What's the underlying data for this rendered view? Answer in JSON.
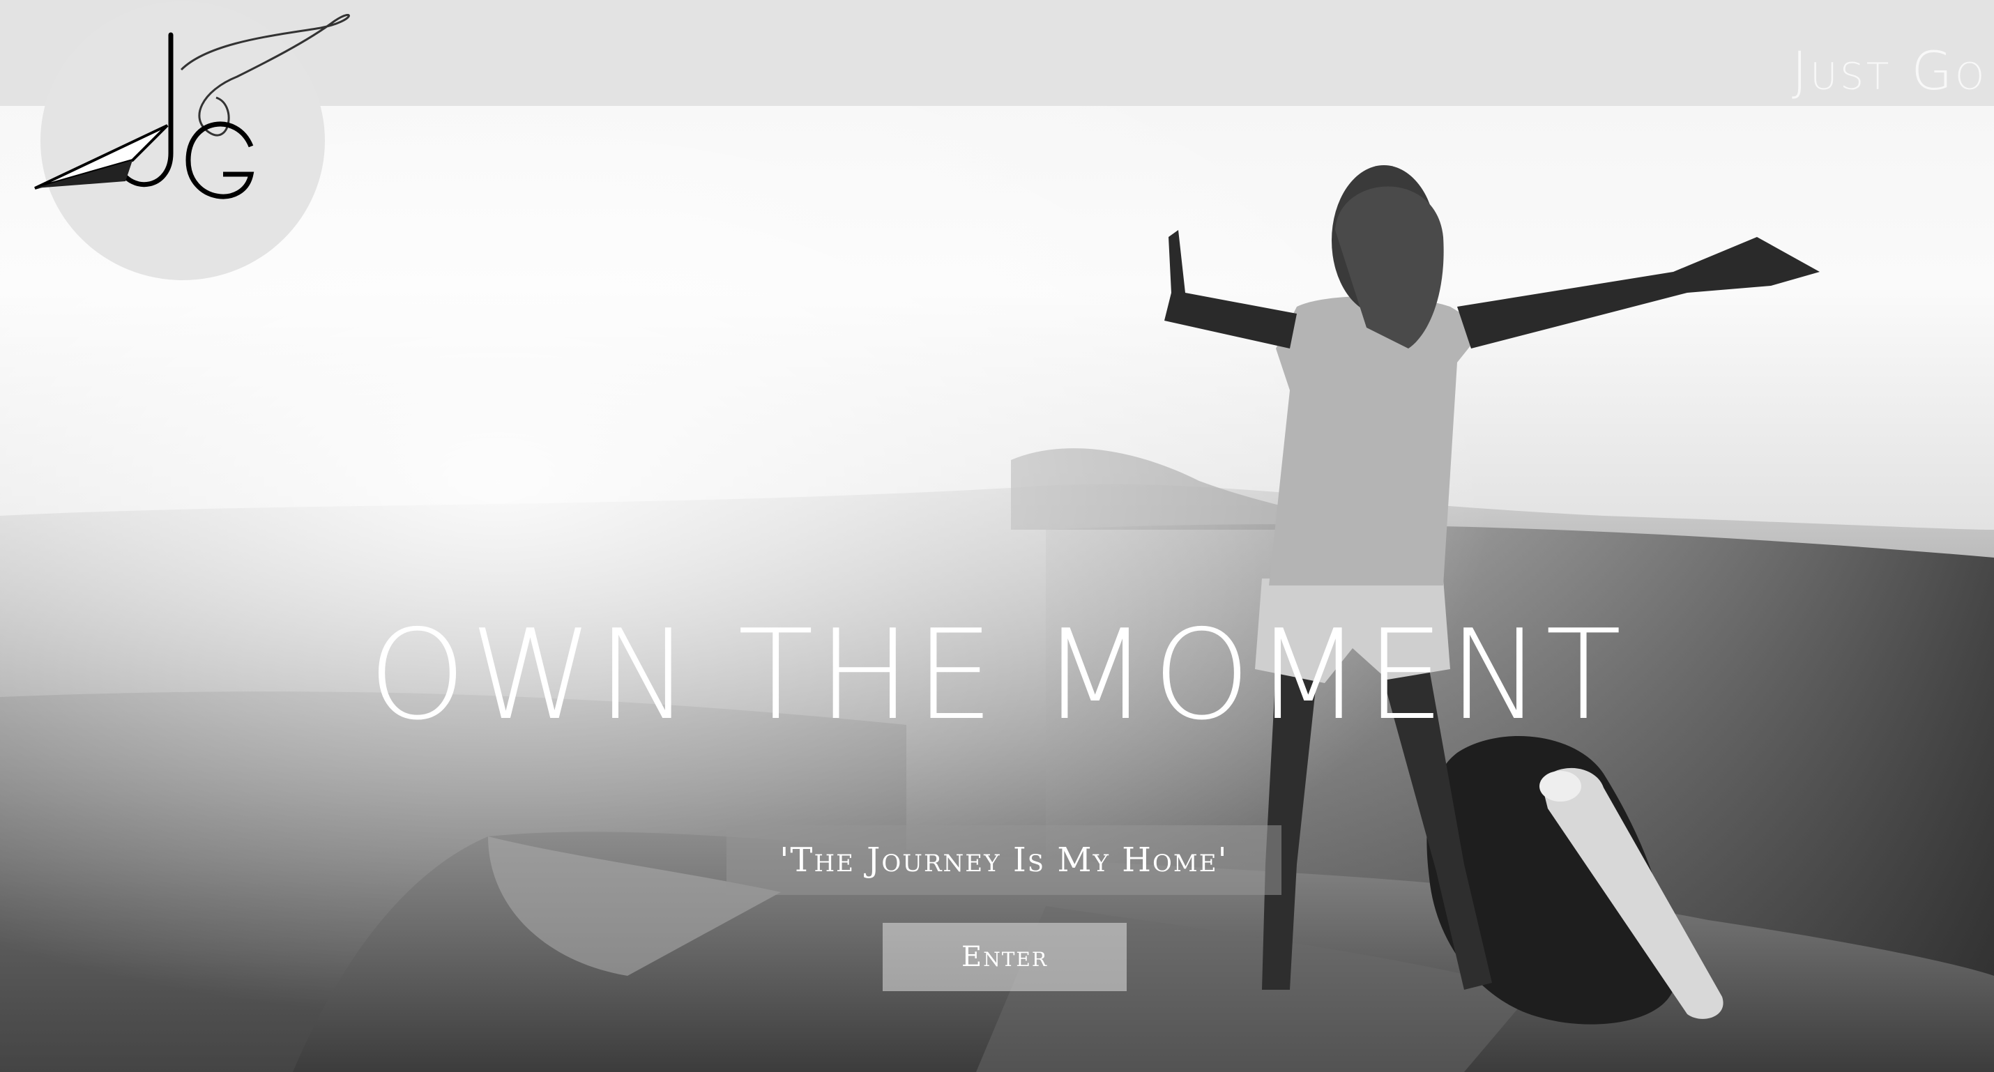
{
  "header": {
    "logo_icon": "jg-paper-plane-logo-icon",
    "brand_text": "Just Go"
  },
  "hero": {
    "image_description_icon": "woman-on-mountain-photo",
    "headline": "OWN THE MOMENT",
    "tagline": "'The Journey Is My Home'",
    "enter_label": "Enter"
  },
  "colors": {
    "headline": "#ffffff",
    "topbar": "#e2e2e2",
    "logo_circle": "#e4e4e4"
  }
}
